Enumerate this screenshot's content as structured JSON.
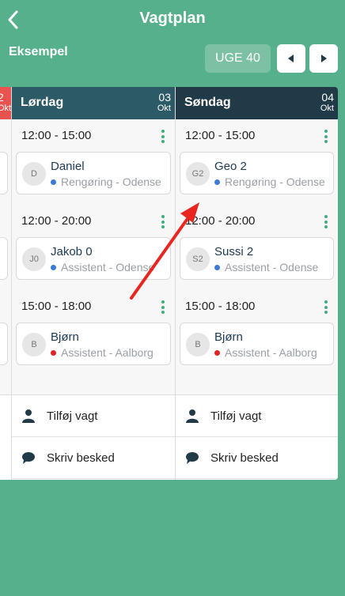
{
  "header": {
    "title": "Vagtplan",
    "subtitle": "Eksempel",
    "week_label": "UGE 40"
  },
  "prev_day": {
    "date": "2",
    "month": "Okt"
  },
  "days": [
    {
      "name": "Lørdag",
      "date": "03",
      "month": "Okt",
      "shifts": [
        {
          "time": "12:00 - 15:00",
          "initials": "D",
          "name": "Daniel",
          "role": "Rengøring - Odense",
          "dot_color": "#3a7bd5"
        },
        {
          "time": "12:00 - 20:00",
          "initials": "J0",
          "name": "Jakob 0",
          "role": "Assistent - Odense",
          "dot_color": "#3a7bd5"
        },
        {
          "time": "15:00 - 18:00",
          "initials": "B",
          "name": "Bjørn",
          "role": "Assistent - Aalborg",
          "dot_color": "#e02424"
        }
      ]
    },
    {
      "name": "Søndag",
      "date": "04",
      "month": "Okt",
      "shifts": [
        {
          "time": "12:00 - 15:00",
          "initials": "G2",
          "name": "Geo 2",
          "role": "Rengøring - Odense",
          "dot_color": "#3a7bd5"
        },
        {
          "time": "12:00 - 20:00",
          "initials": "S2",
          "name": "Sussi 2",
          "role": "Assistent - Odense",
          "dot_color": "#3a7bd5"
        },
        {
          "time": "15:00 - 18:00",
          "initials": "B",
          "name": "Bjørn",
          "role": "Assistent - Aalborg",
          "dot_color": "#e02424"
        }
      ]
    }
  ],
  "actions": {
    "add_shift": "Tilføj vagt",
    "write_message": "Skriv besked"
  },
  "colors": {
    "background": "#55b08b",
    "accent": "#3fae7e",
    "saturday_header": "#2c5a66",
    "sunday_header": "#213a47",
    "friday_header": "#e8524f",
    "annotation_arrow": "#e8261f"
  },
  "icons": [
    "chevron-left-icon",
    "triangle-left-icon",
    "triangle-right-icon",
    "more-vertical-icon",
    "person-icon",
    "chat-bubble-icon"
  ]
}
